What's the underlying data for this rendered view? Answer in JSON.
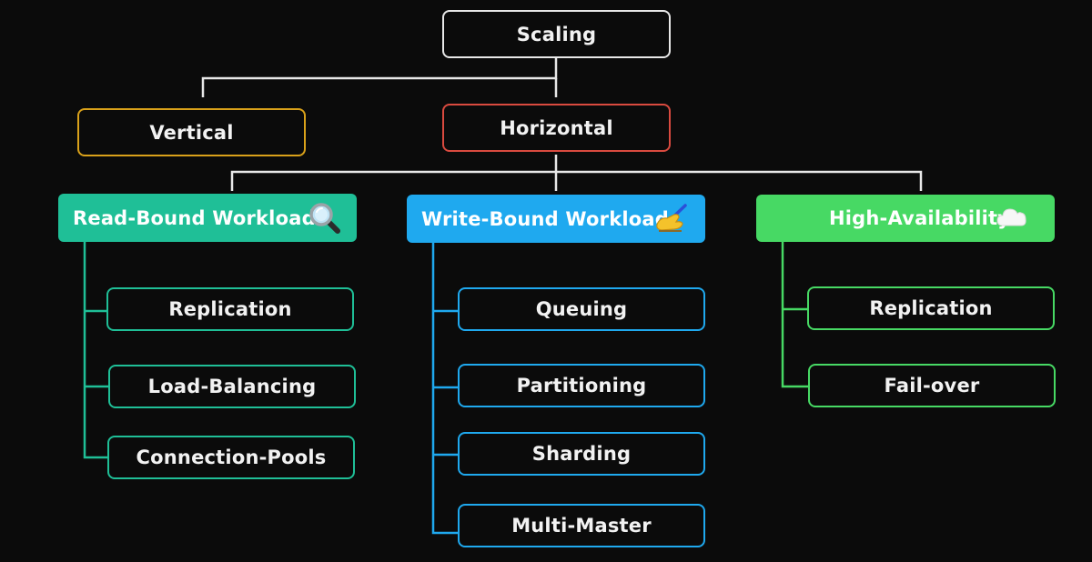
{
  "diagram": {
    "root": {
      "label": "Scaling",
      "color": "#e8e8e8"
    },
    "vertical": {
      "label": "Vertical",
      "color": "#d9a11a"
    },
    "horizontal": {
      "label": "Horizontal",
      "color": "#d94a3f"
    },
    "branches": [
      {
        "label": "Read-Bound Workload",
        "icon": "magnifying-glass-icon",
        "color": "#1fbf97",
        "items": [
          "Replication",
          "Load-Balancing",
          "Connection-Pools"
        ]
      },
      {
        "label": "Write-Bound Workload",
        "icon": "writing-hand-icon",
        "color": "#1fa9ef",
        "items": [
          "Queuing",
          "Partitioning",
          "Sharding",
          "Multi-Master"
        ]
      },
      {
        "label": "High-Availability",
        "icon": "cloud-icon",
        "color": "#47d964",
        "items": [
          "Replication",
          "Fail-over"
        ]
      }
    ]
  }
}
